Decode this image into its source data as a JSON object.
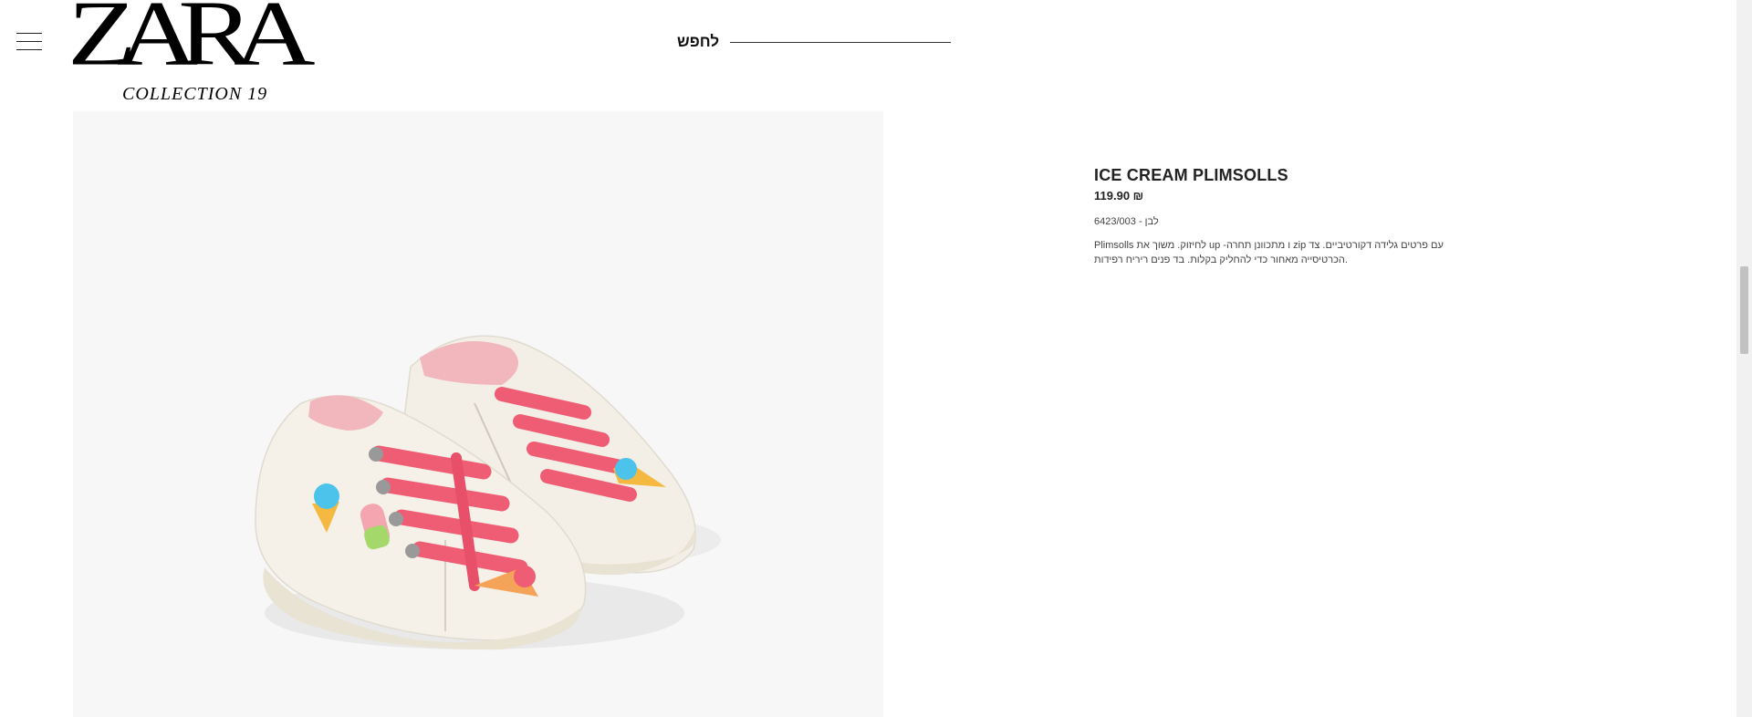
{
  "header": {
    "logo_text": "ZARA",
    "logo_subtitle": "COLLECTION 19",
    "search_label": "לחפש",
    "menu_icon": "hamburger-menu-icon"
  },
  "product": {
    "name": "ICE CREAM PLIMSOLLS",
    "price": "119.90 ₪",
    "color_ref": "לבן - 6423/003",
    "description_line1": "Plimsolls לחיזוק. משוך את up -ו מתכוונן תחרה zip עם פרטים גלידה דקורטיביים. צד",
    "description_line2": "הכרטיסייה מאחור כדי להחליק בקלות. בד פנים ריריח רפידות."
  },
  "colors": {
    "image_background": "#f7f7f7",
    "shoe_upper": "#f3efe6",
    "laces": "#ef5d75",
    "lining": "#f2b7bd"
  }
}
